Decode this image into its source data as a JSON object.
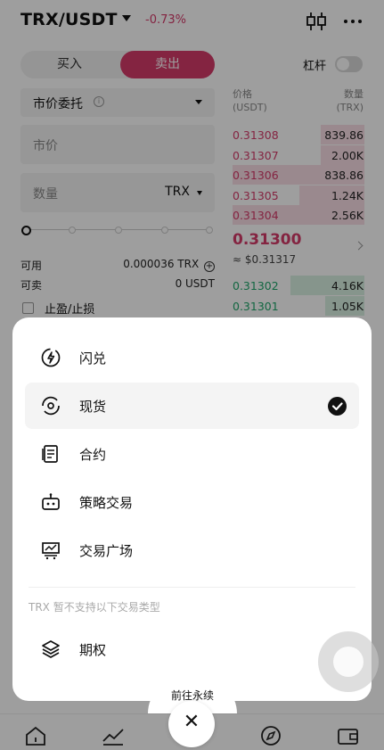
{
  "header": {
    "pair": "TRX/USDT",
    "change": "-0.73%"
  },
  "trade_tabs": {
    "buy": "买入",
    "sell": "卖出"
  },
  "leverage": {
    "label": "杠杆"
  },
  "order_form": {
    "order_type": "市价委托",
    "price_placeholder": "市价",
    "amount_placeholder": "数量",
    "amount_unit": "TRX",
    "available_label": "可用",
    "available_value": "0.000036 TRX",
    "sellable_label": "可卖",
    "sellable_value": "0 USDT",
    "tpsl_label": "止盈/止损"
  },
  "orderbook": {
    "price_header": "价格",
    "price_unit": "(USDT)",
    "qty_header": "数量",
    "qty_unit": "(TRX)",
    "asks": [
      {
        "price": "0.31308",
        "qty": "839.86",
        "depth": 0.33
      },
      {
        "price": "0.31307",
        "qty": "2.00K",
        "depth": 0.33
      },
      {
        "price": "0.31306",
        "qty": "838.86",
        "depth": 1.0
      },
      {
        "price": "0.31305",
        "qty": "1.24K",
        "depth": 0.49
      },
      {
        "price": "0.31304",
        "qty": "2.56K",
        "depth": 1.0
      }
    ],
    "last_price": "0.31300",
    "last_price_fiat": "≈ $0.31317",
    "bids": [
      {
        "price": "0.31302",
        "qty": "4.16K",
        "depth": 0.56
      },
      {
        "price": "0.31301",
        "qty": "1.05K",
        "depth": 0.3
      }
    ]
  },
  "sheet": {
    "items": [
      {
        "label": "闪兑",
        "icon": "flash-icon",
        "selected": false
      },
      {
        "label": "现货",
        "icon": "spot-icon",
        "selected": true
      },
      {
        "label": "合约",
        "icon": "contract-icon",
        "selected": false
      },
      {
        "label": "策略交易",
        "icon": "bot-icon",
        "selected": false
      },
      {
        "label": "交易广场",
        "icon": "market-icon",
        "selected": false
      }
    ],
    "unsupported_text": "TRX 暂不支持以下交易类型",
    "unsupported_items": [
      {
        "label": "期权",
        "icon": "layers-icon"
      }
    ],
    "perpetual_link": "前往永续",
    "close_symbol": "✕"
  },
  "colors": {
    "sell": "#d63a6a",
    "buy": "#1fa76b"
  }
}
